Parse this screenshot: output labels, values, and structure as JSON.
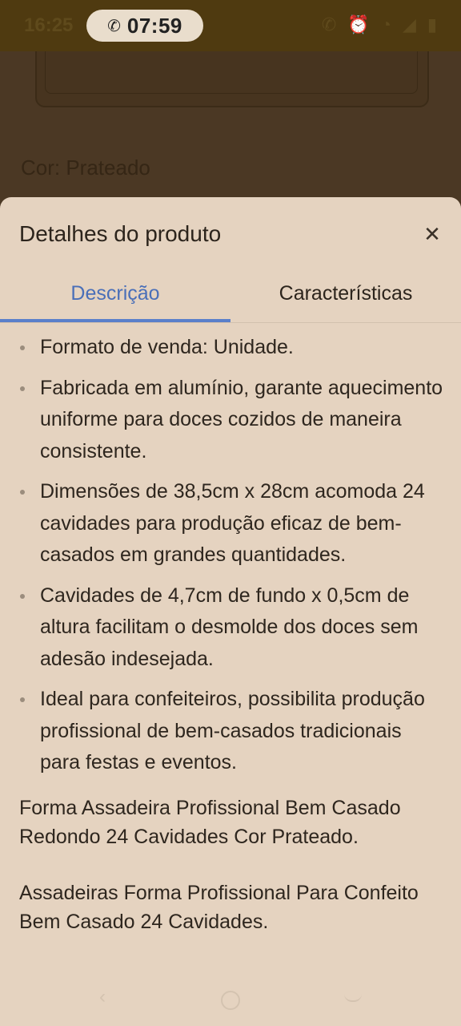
{
  "status_bar": {
    "time": "16:25",
    "call_duration": "07:59",
    "icons": [
      "call-icon",
      "alarm-icon",
      "wifi-icon",
      "signal-icon",
      "battery-icon"
    ]
  },
  "background_page": {
    "color_label": "Cor: Prateado"
  },
  "sheet": {
    "title": "Detalhes do produto",
    "close_icon": "close-icon",
    "tabs": [
      {
        "label": "Descrição",
        "active": true
      },
      {
        "label": "Características",
        "active": false
      }
    ],
    "bullets": [
      "Formato de venda: Unidade.",
      "Fabricada em alumínio, garante aquecimento uniforme para doces cozidos de maneira consistente.",
      "Dimensões de 38,5cm x 28cm acomoda 24 cavidades para produção eficaz de bem-casados em grandes quantidades.",
      "Cavidades de 4,7cm de fundo x 0,5cm de altura facilitam o desmolde dos doces sem adesão indesejada.",
      "Ideal para confeiteiros, possibilita produção profissional de bem-casados tradicionais para festas e eventos."
    ],
    "paragraphs": [
      "Forma Assadeira Profissional Bem Casado Redondo 24 Cavidades Cor Prateado.",
      "Assadeiras Forma Profissional Para Confeito Bem Casado 24 Cavidades."
    ]
  },
  "colors": {
    "accent": "#4a6fb8",
    "sheet_background": "#e5d3c0",
    "overlay": "#4a3722"
  }
}
